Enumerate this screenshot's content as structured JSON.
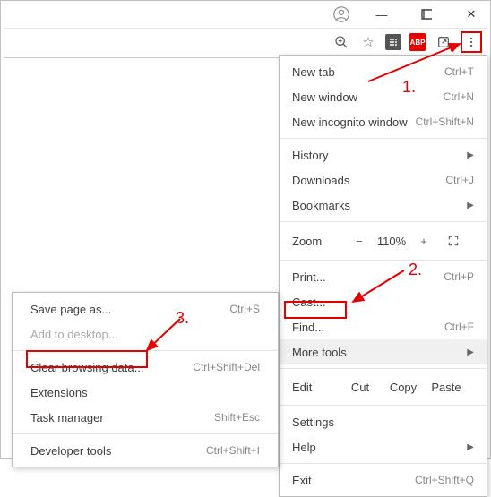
{
  "window": {
    "minimize": "—",
    "maximize": "☐",
    "close": "✕"
  },
  "toolbar": {
    "zoom_icon": "⊕",
    "star_icon": "☆",
    "abp": "ABP",
    "share_icon": "↗"
  },
  "menu": {
    "new_tab": {
      "label": "New tab",
      "shortcut": "Ctrl+T"
    },
    "new_window": {
      "label": "New window",
      "shortcut": "Ctrl+N"
    },
    "new_incognito": {
      "label": "New incognito window",
      "shortcut": "Ctrl+Shift+N"
    },
    "history": {
      "label": "History"
    },
    "downloads": {
      "label": "Downloads",
      "shortcut": "Ctrl+J"
    },
    "bookmarks": {
      "label": "Bookmarks"
    },
    "zoom": {
      "label": "Zoom",
      "minus": "−",
      "pct": "110%",
      "plus": "+"
    },
    "print": {
      "label": "Print...",
      "shortcut": "Ctrl+P"
    },
    "cast": {
      "label": "Cast..."
    },
    "find": {
      "label": "Find...",
      "shortcut": "Ctrl+F"
    },
    "more_tools": {
      "label": "More tools"
    },
    "edit": {
      "label": "Edit",
      "cut": "Cut",
      "copy": "Copy",
      "paste": "Paste"
    },
    "settings": {
      "label": "Settings"
    },
    "help": {
      "label": "Help"
    },
    "exit": {
      "label": "Exit",
      "shortcut": "Ctrl+Shift+Q"
    }
  },
  "submenu": {
    "save_page": {
      "label": "Save page as...",
      "shortcut": "Ctrl+S"
    },
    "add_desktop": {
      "label": "Add to desktop..."
    },
    "clear_data": {
      "label": "Clear browsing data...",
      "shortcut": "Ctrl+Shift+Del"
    },
    "extensions": {
      "label": "Extensions"
    },
    "task_manager": {
      "label": "Task manager",
      "shortcut": "Shift+Esc"
    },
    "dev_tools": {
      "label": "Developer tools",
      "shortcut": "Ctrl+Shift+I"
    }
  },
  "annotations": {
    "step1": "1.",
    "step2": "2.",
    "step3": "3."
  }
}
